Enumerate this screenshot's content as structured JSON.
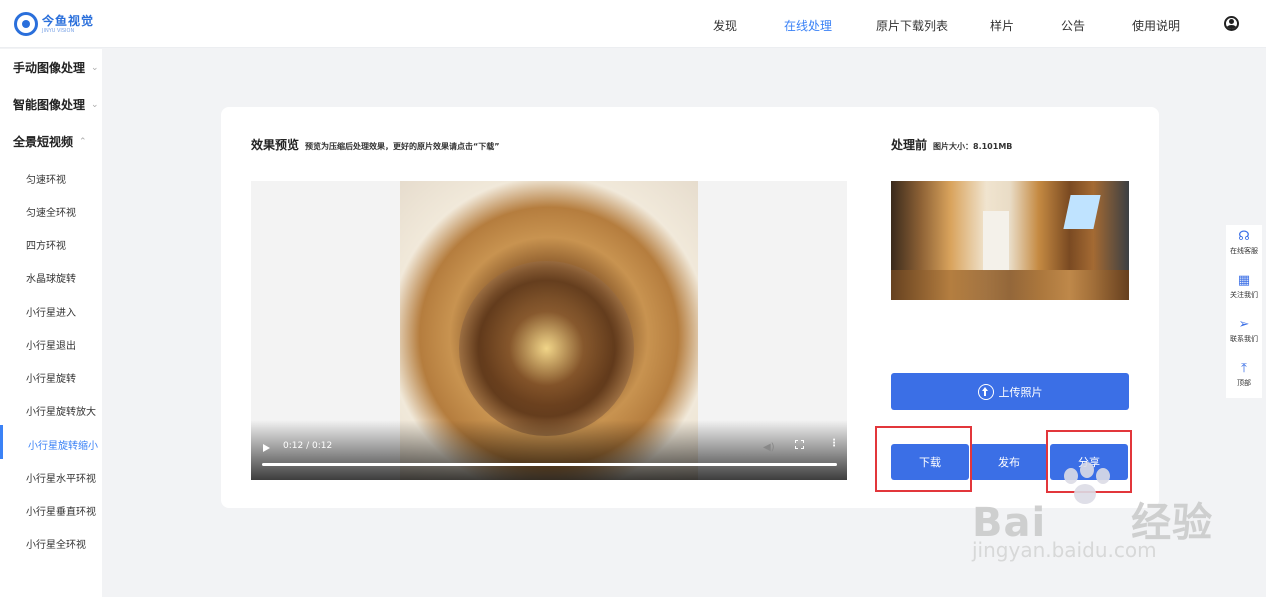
{
  "brand": {
    "name": "今鱼视觉",
    "tagline": "JINYU VISION"
  },
  "nav": [
    {
      "label": "发现",
      "active": false
    },
    {
      "label": "在线处理",
      "active": true
    },
    {
      "label": "原片下载列表",
      "active": false
    },
    {
      "label": "样片",
      "active": false
    },
    {
      "label": "公告",
      "active": false
    },
    {
      "label": "使用说明",
      "active": false
    }
  ],
  "sidebar": {
    "groups": [
      {
        "label": "手动图像处理",
        "chevron": "⌄"
      },
      {
        "label": "智能图像处理",
        "chevron": "⌄"
      },
      {
        "label": "全景短视频",
        "chevron": "⌃"
      }
    ],
    "items": [
      "匀速环视",
      "匀速全环视",
      "四方环视",
      "水晶球旋转",
      "小行星进入",
      "小行星退出",
      "小行星旋转",
      "小行星旋转放大",
      "小行星旋转缩小",
      "小行星水平环视",
      "小行星垂直环视",
      "小行星全环视"
    ],
    "active_index": 8
  },
  "preview": {
    "title": "效果预览",
    "subtitle": "预览为压缩后处理效果，更好的原片效果请点击“下载”",
    "time": "0:12 / 0:12"
  },
  "before": {
    "title": "处理前",
    "size_label": "图片大小：8.101MB"
  },
  "buttons": {
    "upload": "上传照片",
    "download": "下载",
    "publish": "发布",
    "share": "分享"
  },
  "float_panel": [
    {
      "label": "在线客服",
      "icon": "headset-icon"
    },
    {
      "label": "关注我们",
      "icon": "qr-code-icon"
    },
    {
      "label": "联系我们",
      "icon": "paper-plane-icon"
    },
    {
      "label": "顶部",
      "icon": "back-to-top-icon"
    }
  ],
  "watermark": {
    "big": "Bai",
    "big2": "经验",
    "small": "jingyan.baidu.com"
  },
  "colors": {
    "accent": "#3b6fe6",
    "nav_active": "#3b82f6",
    "highlight": "#e2363b"
  }
}
